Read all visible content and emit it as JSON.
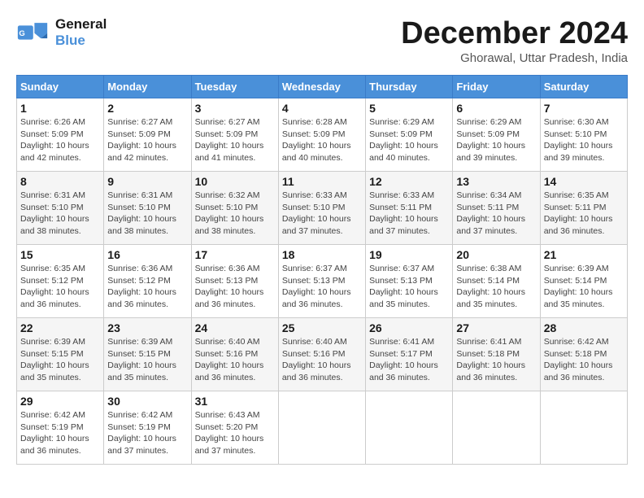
{
  "logo": {
    "line1": "General",
    "line2": "Blue"
  },
  "title": "December 2024",
  "subtitle": "Ghorawal, Uttar Pradesh, India",
  "headers": [
    "Sunday",
    "Monday",
    "Tuesday",
    "Wednesday",
    "Thursday",
    "Friday",
    "Saturday"
  ],
  "weeks": [
    [
      {
        "day": "1",
        "info": "Sunrise: 6:26 AM\nSunset: 5:09 PM\nDaylight: 10 hours\nand 42 minutes."
      },
      {
        "day": "2",
        "info": "Sunrise: 6:27 AM\nSunset: 5:09 PM\nDaylight: 10 hours\nand 42 minutes."
      },
      {
        "day": "3",
        "info": "Sunrise: 6:27 AM\nSunset: 5:09 PM\nDaylight: 10 hours\nand 41 minutes."
      },
      {
        "day": "4",
        "info": "Sunrise: 6:28 AM\nSunset: 5:09 PM\nDaylight: 10 hours\nand 40 minutes."
      },
      {
        "day": "5",
        "info": "Sunrise: 6:29 AM\nSunset: 5:09 PM\nDaylight: 10 hours\nand 40 minutes."
      },
      {
        "day": "6",
        "info": "Sunrise: 6:29 AM\nSunset: 5:09 PM\nDaylight: 10 hours\nand 39 minutes."
      },
      {
        "day": "7",
        "info": "Sunrise: 6:30 AM\nSunset: 5:10 PM\nDaylight: 10 hours\nand 39 minutes."
      }
    ],
    [
      {
        "day": "8",
        "info": "Sunrise: 6:31 AM\nSunset: 5:10 PM\nDaylight: 10 hours\nand 38 minutes."
      },
      {
        "day": "9",
        "info": "Sunrise: 6:31 AM\nSunset: 5:10 PM\nDaylight: 10 hours\nand 38 minutes."
      },
      {
        "day": "10",
        "info": "Sunrise: 6:32 AM\nSunset: 5:10 PM\nDaylight: 10 hours\nand 38 minutes."
      },
      {
        "day": "11",
        "info": "Sunrise: 6:33 AM\nSunset: 5:10 PM\nDaylight: 10 hours\nand 37 minutes."
      },
      {
        "day": "12",
        "info": "Sunrise: 6:33 AM\nSunset: 5:11 PM\nDaylight: 10 hours\nand 37 minutes."
      },
      {
        "day": "13",
        "info": "Sunrise: 6:34 AM\nSunset: 5:11 PM\nDaylight: 10 hours\nand 37 minutes."
      },
      {
        "day": "14",
        "info": "Sunrise: 6:35 AM\nSunset: 5:11 PM\nDaylight: 10 hours\nand 36 minutes."
      }
    ],
    [
      {
        "day": "15",
        "info": "Sunrise: 6:35 AM\nSunset: 5:12 PM\nDaylight: 10 hours\nand 36 minutes."
      },
      {
        "day": "16",
        "info": "Sunrise: 6:36 AM\nSunset: 5:12 PM\nDaylight: 10 hours\nand 36 minutes."
      },
      {
        "day": "17",
        "info": "Sunrise: 6:36 AM\nSunset: 5:13 PM\nDaylight: 10 hours\nand 36 minutes."
      },
      {
        "day": "18",
        "info": "Sunrise: 6:37 AM\nSunset: 5:13 PM\nDaylight: 10 hours\nand 36 minutes."
      },
      {
        "day": "19",
        "info": "Sunrise: 6:37 AM\nSunset: 5:13 PM\nDaylight: 10 hours\nand 35 minutes."
      },
      {
        "day": "20",
        "info": "Sunrise: 6:38 AM\nSunset: 5:14 PM\nDaylight: 10 hours\nand 35 minutes."
      },
      {
        "day": "21",
        "info": "Sunrise: 6:39 AM\nSunset: 5:14 PM\nDaylight: 10 hours\nand 35 minutes."
      }
    ],
    [
      {
        "day": "22",
        "info": "Sunrise: 6:39 AM\nSunset: 5:15 PM\nDaylight: 10 hours\nand 35 minutes."
      },
      {
        "day": "23",
        "info": "Sunrise: 6:39 AM\nSunset: 5:15 PM\nDaylight: 10 hours\nand 35 minutes."
      },
      {
        "day": "24",
        "info": "Sunrise: 6:40 AM\nSunset: 5:16 PM\nDaylight: 10 hours\nand 36 minutes."
      },
      {
        "day": "25",
        "info": "Sunrise: 6:40 AM\nSunset: 5:16 PM\nDaylight: 10 hours\nand 36 minutes."
      },
      {
        "day": "26",
        "info": "Sunrise: 6:41 AM\nSunset: 5:17 PM\nDaylight: 10 hours\nand 36 minutes."
      },
      {
        "day": "27",
        "info": "Sunrise: 6:41 AM\nSunset: 5:18 PM\nDaylight: 10 hours\nand 36 minutes."
      },
      {
        "day": "28",
        "info": "Sunrise: 6:42 AM\nSunset: 5:18 PM\nDaylight: 10 hours\nand 36 minutes."
      }
    ],
    [
      {
        "day": "29",
        "info": "Sunrise: 6:42 AM\nSunset: 5:19 PM\nDaylight: 10 hours\nand 36 minutes."
      },
      {
        "day": "30",
        "info": "Sunrise: 6:42 AM\nSunset: 5:19 PM\nDaylight: 10 hours\nand 37 minutes."
      },
      {
        "day": "31",
        "info": "Sunrise: 6:43 AM\nSunset: 5:20 PM\nDaylight: 10 hours\nand 37 minutes."
      },
      null,
      null,
      null,
      null
    ]
  ]
}
